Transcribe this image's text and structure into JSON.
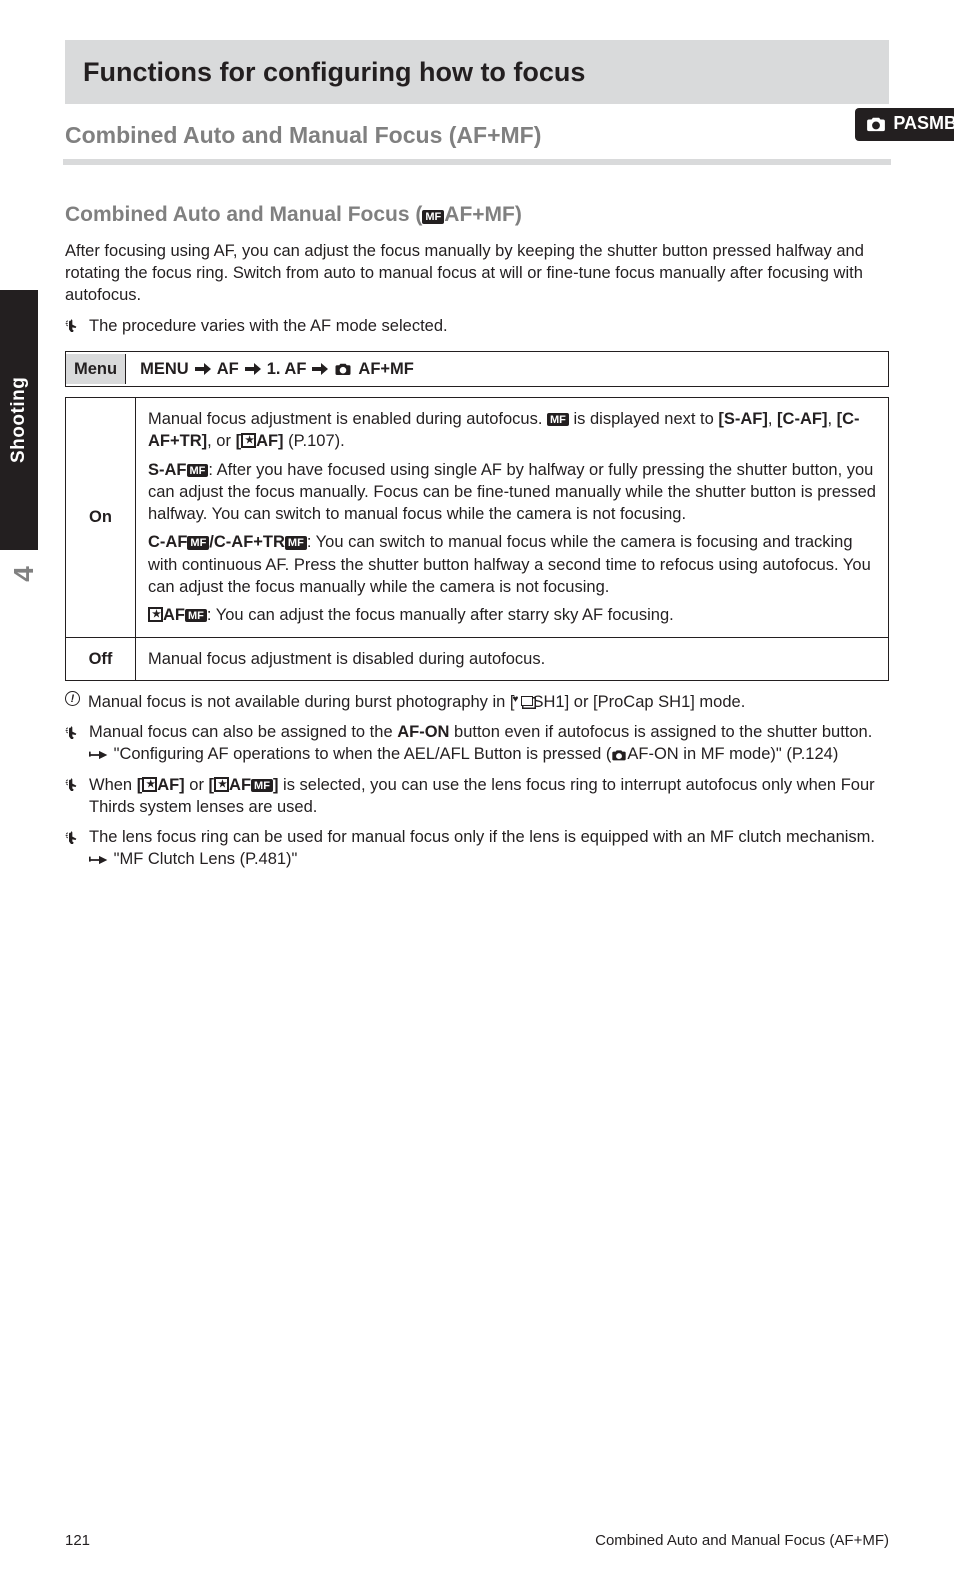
{
  "sideTab": "Shooting",
  "sideNum": "4",
  "header": "Functions for configuring how to focus",
  "subheader": "Combined Auto and Manual Focus (AF+MF)",
  "modesLabel": "PASMB",
  "section": "Combined Auto and Manual Focus",
  "menuItem": "AF+MF",
  "intro1": "After focusing using AF, you can adjust the focus manually by keeping the shutter button pressed halfway and rotating the focus ring. Switch from auto to manual focus at will or fine-tune focus manually after focusing with autofocus.",
  "tip1": "The procedure varies with the AF mode selected.",
  "nav": {
    "label": "Menu",
    "step1": "MENU",
    "step2": "AF",
    "step3": "1. AF",
    "step4": "AF+MF"
  },
  "options": {
    "on": {
      "k": "On",
      "p1_a": "Manual focus adjustment is enabled during autofocus. ",
      "p1_b": " is displayed next to ",
      "p1_c": "[S-AF]",
      "p1_d": ", ",
      "p1_e": "[C-AF]",
      "p1_f": ", ",
      "p1_g": "[C-AF+TR]",
      "p1_h": ", or ",
      "p1_i": "[",
      "p1_j": "AF]",
      "p1_k": " (P.107).",
      "sAF": "S-AF",
      "sAF_desc": ": After you have focused using single AF by halfway or fully pressing the shutter button, you can adjust the focus manually. Focus can be fine-tuned manually while the shutter button is pressed halfway. You can switch to manual focus while the camera is not focusing.",
      "cAF_a": "C-AF",
      "cAF_b": "/C-AF+TR",
      "cAF_desc": ": You can switch to manual focus while the camera is focusing and tracking with continuous AF. Press the shutter button halfway a second time to refocus using autofocus. You can adjust the focus manually while the camera is not focusing.",
      "starAF": "AF",
      "starAF_desc": ": You can adjust the focus manually after starry sky AF focusing."
    },
    "off": {
      "k": "Off",
      "desc": "Manual focus adjustment is disabled during autofocus."
    }
  },
  "note": "Manual focus is not available during burst photography in [",
  "note_b": "SH1] or [ProCap SH1] mode.",
  "tips": {
    "t1_a": "Manual focus can also be assigned to the ",
    "t1_b": "AF-ON",
    "t1_c": " button even if autofocus is assigned to the shutter button. ",
    "t1_d": " \"Configuring AF operations to when the AEL/AFL Button is pressed (",
    "t1_e": "AF-ON in MF mode)\" (P.124)",
    "t2_a": "When ",
    "t2_b": "[",
    "t2_c": "AF]",
    "t2_d": " or ",
    "t2_e": "[",
    "t2_f": "AF",
    "t2_g": "]",
    "t2_h": " is selected, you can use the lens focus ring to interrupt autofocus only when Four Thirds system lenses are used.",
    "t3_a": "The lens focus ring can be used for manual focus only if the lens is equipped with an MF clutch mechanism. ",
    "t3_b": " \"MF Clutch Lens (P.481)\""
  },
  "footer": {
    "pg": "121",
    "title": "Combined Auto and Manual Focus (AF+MF)"
  }
}
